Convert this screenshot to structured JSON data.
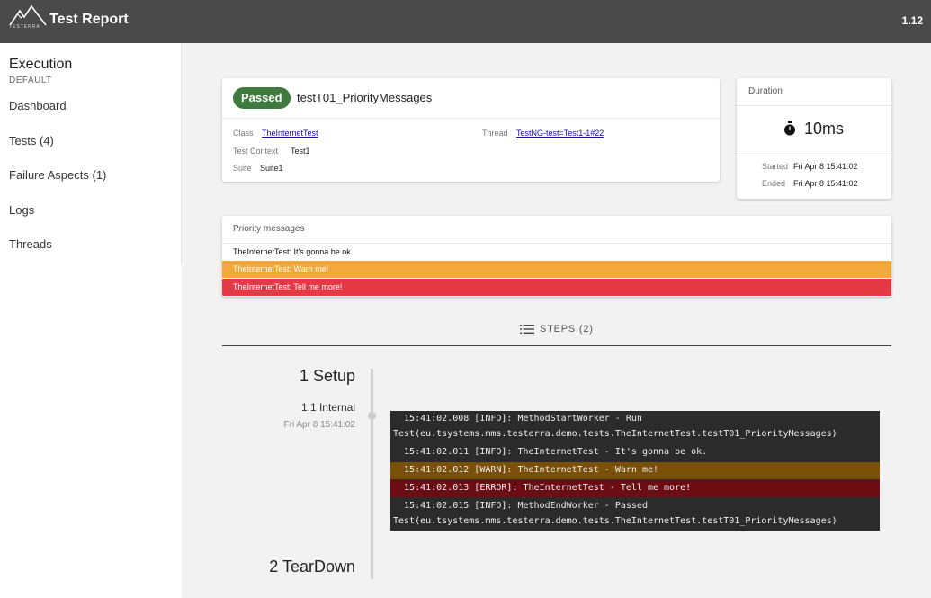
{
  "header": {
    "title": "Test Report",
    "version": "1.12",
    "logo_text": "TESTERRA"
  },
  "sidebar": {
    "title": "Execution",
    "subtitle": "DEFAULT",
    "items": [
      {
        "label": "Dashboard"
      },
      {
        "label": "Tests (4)"
      },
      {
        "label": "Failure Aspects (1)"
      },
      {
        "label": "Logs"
      },
      {
        "label": "Threads"
      }
    ]
  },
  "test": {
    "status": "Passed",
    "name": "testT01_PriorityMessages",
    "class_label": "Class",
    "class_value": "TheInternetTest",
    "thread_label": "Thread",
    "thread_value": "TestNG-test=Test1-1#22",
    "context_label": "Test Context",
    "context_value": "Test1",
    "suite_label": "Suite",
    "suite_value": "Suite1"
  },
  "duration": {
    "title": "Duration",
    "value": "10ms",
    "started_label": "Started",
    "started_value": "Fri Apr 8 15:41:02",
    "ended_label": "Ended",
    "ended_value": "Fri Apr 8 15:41:02"
  },
  "priority": {
    "title": "Priority messages",
    "messages": [
      {
        "level": "info",
        "source": "TheInternetTest",
        "text": ": It's gonna be ok."
      },
      {
        "level": "warn",
        "source": "TheInternetTest",
        "text": ": Warn me!"
      },
      {
        "level": "error",
        "source": "TheInternetTest",
        "text": ": Tell me more!"
      }
    ]
  },
  "steps": {
    "tab_label": "STEPS (2)",
    "items": [
      {
        "title": "1 Setup"
      },
      {
        "title": "2 TearDown"
      }
    ],
    "substep": {
      "title": "1.1 Internal",
      "time": "Fri Apr 8 15:41:02"
    }
  },
  "log": {
    "lines": [
      "  15:41:02.008 [INFO]: MethodStartWorker - Run",
      "Test(eu.tsystems.mms.testerra.demo.tests.TheInternetTest.testT01_PriorityMessages)",
      "  15:41:02.011 [INFO]: TheInternetTest - It's gonna be ok.",
      "  15:41:02.012 [WARN]: TheInternetTest - Warn me!",
      "  15:41:02.013 [ERROR]: TheInternetTest - Tell me more!",
      "  15:41:02.015 [INFO]: MethodEndWorker - Passed",
      "Test(eu.tsystems.mms.testerra.demo.tests.TheInternetTest.testT01_PriorityMessages)"
    ]
  },
  "colors": {
    "passed": "#3f7a3f",
    "warn": "#f5a83a",
    "error": "#e63946",
    "appbar": "#4a4a4a"
  }
}
